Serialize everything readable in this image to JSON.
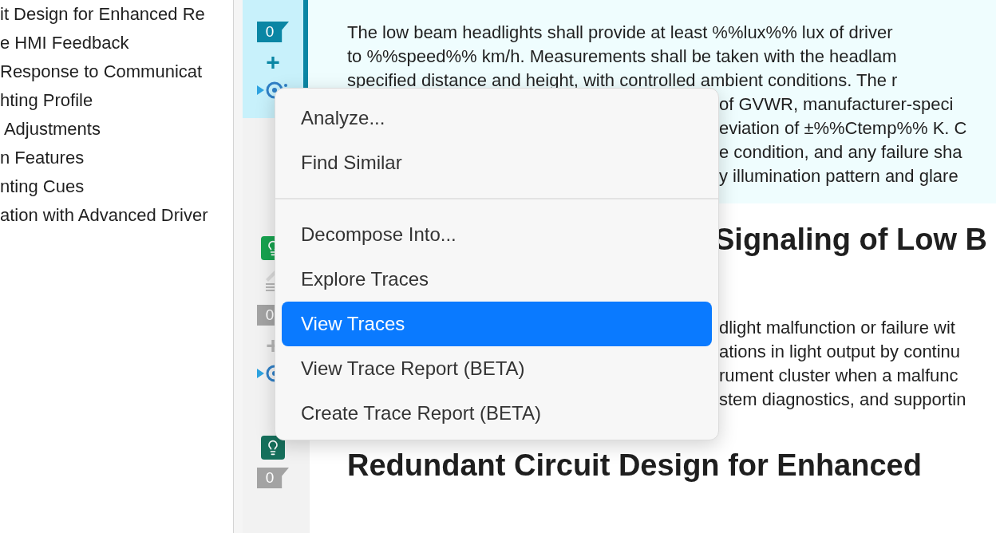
{
  "outline": {
    "items": [
      {
        "label": "it Design for Enhanced Re"
      },
      {
        "label": "e HMI Feedback"
      },
      {
        "label": "Response to Communicat"
      },
      {
        "label": "hting Profile"
      },
      {
        "label": " Adjustments"
      },
      {
        "label": "n Features"
      },
      {
        "label": "nting Cues"
      },
      {
        "label": "ation with Advanced Driver"
      }
    ]
  },
  "gutter": {
    "blocks": [
      {
        "selected": true,
        "badge": "0",
        "plus": "+",
        "linked": true
      },
      {
        "selected": false,
        "icons": [
          {
            "kind": "bulb",
            "color": "#17a24f"
          },
          {
            "kind": "pencil"
          }
        ],
        "badge": "0",
        "plus": "+",
        "linked": true
      },
      {
        "selected": false,
        "icons": [
          {
            "kind": "bulb",
            "color": "#16705c"
          }
        ],
        "badge": "0",
        "linked": false
      }
    ]
  },
  "document": {
    "sections": [
      {
        "selected": true,
        "lines": [
          {
            "text": "The low beam headlights shall provide at least %%lux%% lux of driver",
            "covered": false
          },
          {
            "text": "to %%speed%% km/h. Measurements shall be taken with the headlam",
            "covered": false
          },
          {
            "text": "specified distance and height, with controlled ambient conditions. The r",
            "covered": false
          },
          {
            "text": "of GVWR, manufacturer-speci",
            "covered": true
          },
          {
            "text": "eviation of ±%%Ctemp%% K. C",
            "covered": true
          },
          {
            "text": "e condition, and any failure sha",
            "covered": true
          },
          {
            "text": "y illumination pattern and glare",
            "covered": true
          }
        ]
      },
      {
        "selected": false,
        "heading": "Signaling of Low B",
        "heading_covered": true,
        "lines": [
          {
            "text": "dlight malfunction or failure wit",
            "covered": true
          },
          {
            "text": "ations in light output by continu",
            "covered": true
          },
          {
            "text": "rument cluster when a malfunc",
            "covered": true
          },
          {
            "text": "stem diagnostics, and supportin",
            "covered": true
          }
        ]
      },
      {
        "selected": false,
        "heading": "Redundant Circuit Design for Enhanced",
        "heading_covered": false
      }
    ]
  },
  "context_menu": {
    "groups": [
      {
        "items": [
          {
            "label": "Analyze...",
            "selected": false
          },
          {
            "label": "Find Similar",
            "selected": false
          }
        ]
      },
      {
        "items": [
          {
            "label": "Decompose Into...",
            "selected": false
          },
          {
            "label": "Explore Traces",
            "selected": false
          },
          {
            "label": "View Traces",
            "selected": true
          },
          {
            "label": "View Trace Report (BETA)",
            "selected": false
          },
          {
            "label": "Create Trace Report (BETA)",
            "selected": false
          }
        ]
      }
    ]
  }
}
